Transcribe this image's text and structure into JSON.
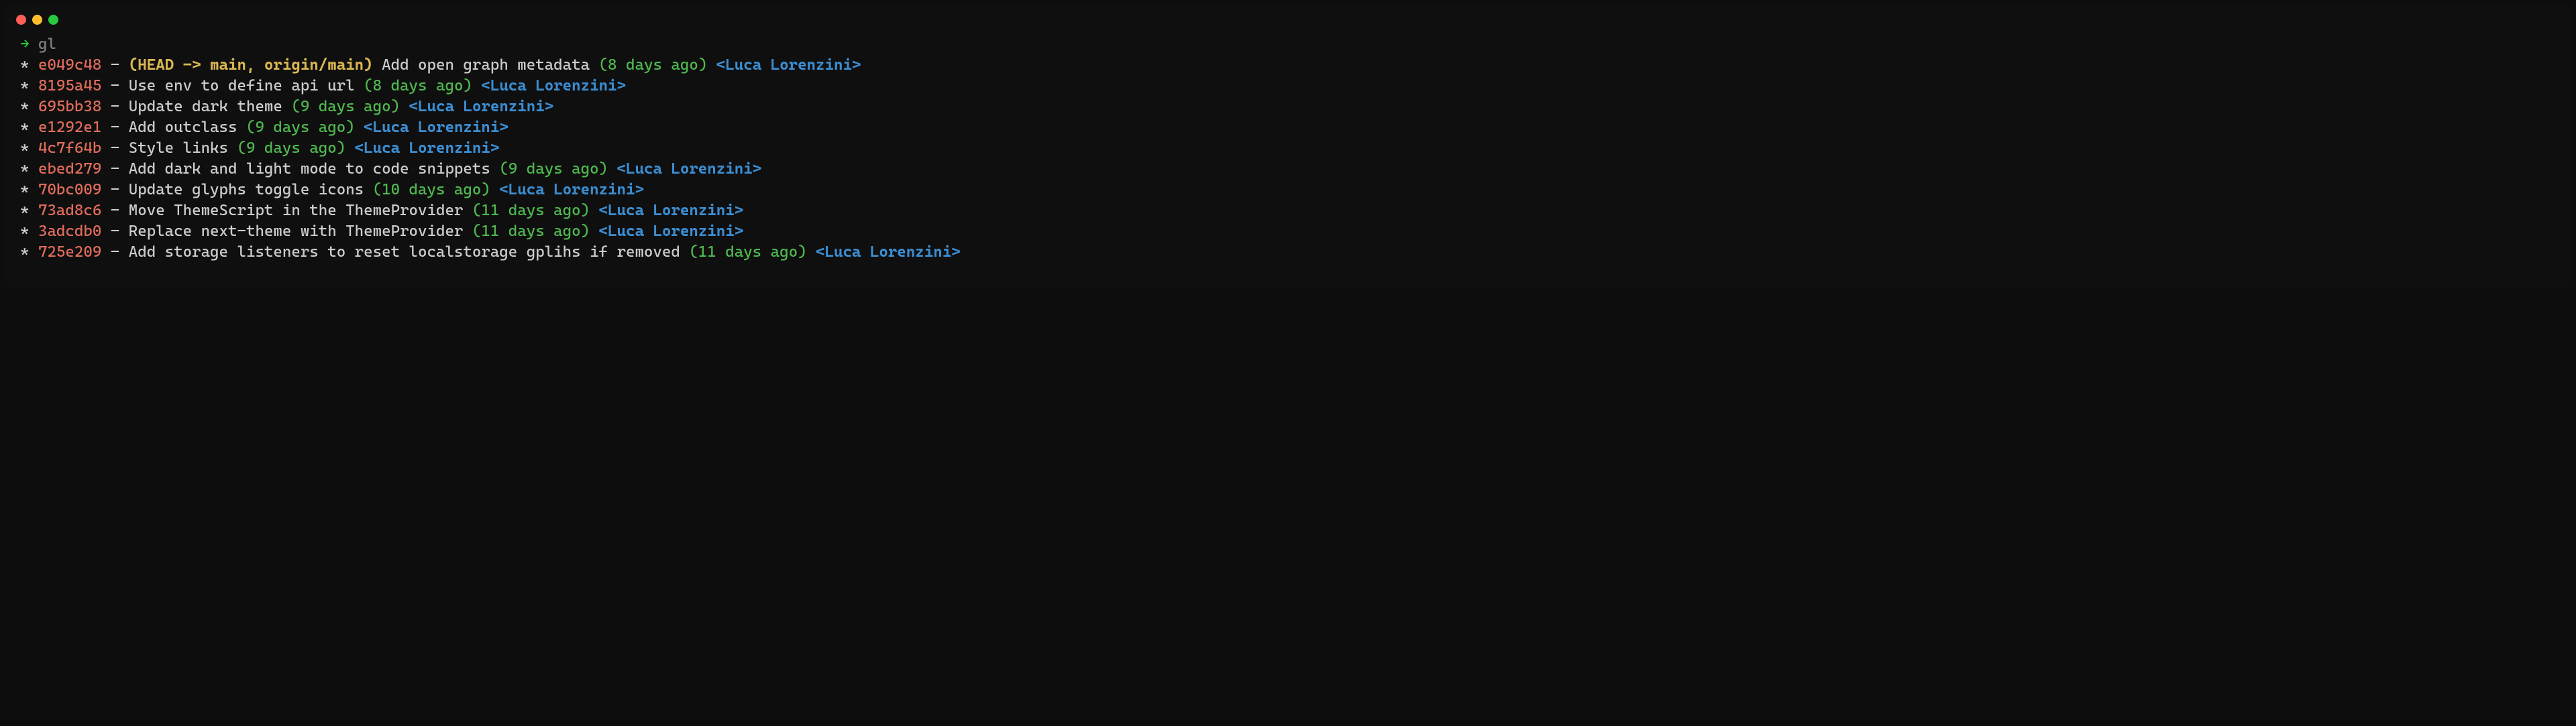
{
  "prompt": {
    "arrow": "→",
    "command": "gl"
  },
  "commits": [
    {
      "star": "*",
      "hash": "e049c48",
      "dash": "-",
      "refs": "(HEAD -> main, origin/main)",
      "message": "Add open graph metadata",
      "time": "(8 days ago)",
      "author": "<Luca Lorenzini>"
    },
    {
      "star": "*",
      "hash": "8195a45",
      "dash": "-",
      "refs": "",
      "message": "Use env to define api url",
      "time": "(8 days ago)",
      "author": "<Luca Lorenzini>"
    },
    {
      "star": "*",
      "hash": "695bb38",
      "dash": "-",
      "refs": "",
      "message": "Update dark theme",
      "time": "(9 days ago)",
      "author": "<Luca Lorenzini>"
    },
    {
      "star": "*",
      "hash": "e1292e1",
      "dash": "-",
      "refs": "",
      "message": "Add outclass",
      "time": "(9 days ago)",
      "author": "<Luca Lorenzini>"
    },
    {
      "star": "*",
      "hash": "4c7f64b",
      "dash": "-",
      "refs": "",
      "message": "Style links",
      "time": "(9 days ago)",
      "author": "<Luca Lorenzini>"
    },
    {
      "star": "*",
      "hash": "ebed279",
      "dash": "-",
      "refs": "",
      "message": "Add dark and light mode to code snippets",
      "time": "(9 days ago)",
      "author": "<Luca Lorenzini>"
    },
    {
      "star": "*",
      "hash": "70bc009",
      "dash": "-",
      "refs": "",
      "message": "Update glyphs toggle icons",
      "time": "(10 days ago)",
      "author": "<Luca Lorenzini>"
    },
    {
      "star": "*",
      "hash": "73ad8c6",
      "dash": "-",
      "refs": "",
      "message": "Move ThemeScript in the ThemeProvider",
      "time": "(11 days ago)",
      "author": "<Luca Lorenzini>"
    },
    {
      "star": "*",
      "hash": "3adcdb0",
      "dash": "-",
      "refs": "",
      "message": "Replace next-theme with ThemeProvider",
      "time": "(11 days ago)",
      "author": "<Luca Lorenzini>"
    },
    {
      "star": "*",
      "hash": "725e209",
      "dash": "-",
      "refs": "",
      "message": "Add storage listeners to reset localstorage gplihs if removed",
      "time": "(11 days ago)",
      "author": "<Luca Lorenzini>"
    }
  ]
}
